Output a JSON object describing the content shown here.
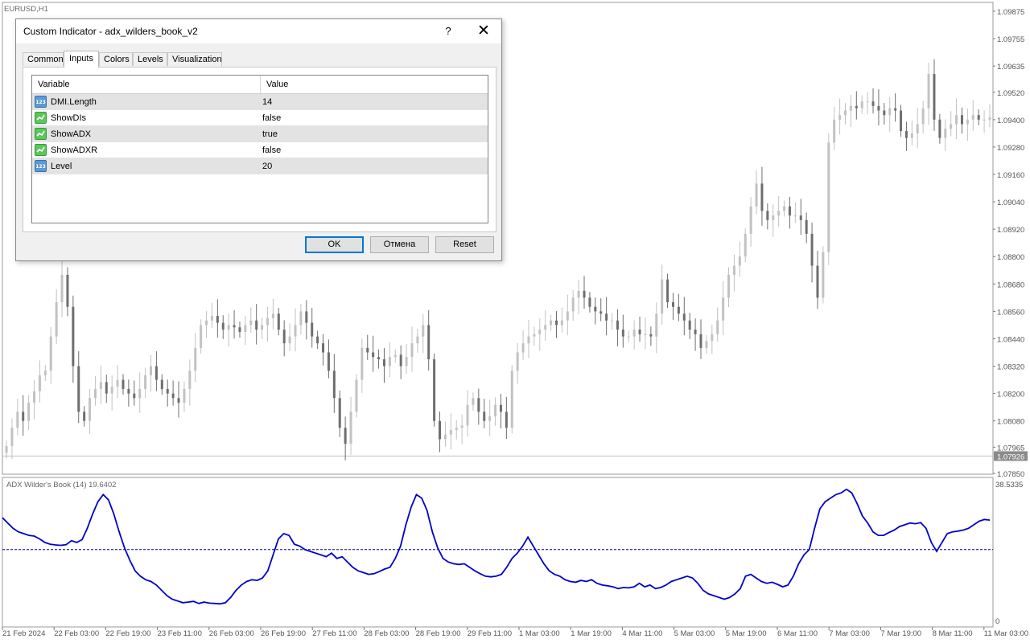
{
  "chart": {
    "symbol_label": "EURUSD,H1",
    "price_levels": [
      "1.09875",
      "1.09755",
      "1.09635",
      "1.09520",
      "1.09400",
      "1.09280",
      "1.09160",
      "1.09040",
      "1.08920",
      "1.08800",
      "1.08680",
      "1.08560",
      "1.08440",
      "1.08320",
      "1.08200",
      "1.08080",
      "1.07965",
      "1.07926",
      "1.07850"
    ],
    "current_price": "1.07926",
    "indicator_label": "ADX Wilder's Book (14) 19.6402",
    "indicator_max": "38.5335",
    "indicator_min": "0",
    "time_labels": [
      "21 Feb 2024",
      "22 Feb 03:00",
      "22 Feb 19:00",
      "23 Feb 11:00",
      "26 Feb 03:00",
      "26 Feb 19:00",
      "27 Feb 11:00",
      "28 Feb 03:00",
      "28 Feb 19:00",
      "29 Feb 11:00",
      "1 Mar 03:00",
      "1 Mar 19:00",
      "4 Mar 11:00",
      "5 Mar 03:00",
      "5 Mar 19:00",
      "6 Mar 11:00",
      "7 Mar 03:00",
      "7 Mar 19:00",
      "8 Mar 11:00",
      "11 Mar 03:00"
    ],
    "colors": {
      "candle": "#808080",
      "adx_line": "#0000cc",
      "level_line": "#000080",
      "grid_bg": "#ffffff"
    }
  },
  "chart_data": {
    "type": "line",
    "series": [
      {
        "name": "ADX Wilder's Book (14)",
        "values": [
          29.0,
          27.5,
          26.0,
          25.0,
          24.5,
          24.0,
          23.8,
          23.0,
          22.0,
          21.5,
          21.3,
          21.2,
          21.4,
          22.5,
          22.0,
          22.8,
          26.0,
          30.0,
          33.5,
          35.5,
          34.0,
          30.0,
          25.0,
          20.5,
          17.0,
          14.0,
          12.5,
          11.5,
          11.0,
          10.0,
          8.5,
          7.0,
          6.0,
          5.5,
          5.0,
          5.2,
          5.4,
          4.8,
          5.2,
          4.9,
          4.8,
          4.7,
          5.0,
          6.5,
          8.5,
          10.0,
          11.0,
          11.5,
          11.3,
          12.0,
          14.0,
          18.5,
          23.0,
          24.5,
          24.0,
          21.5,
          21.0,
          20.0,
          19.5,
          19.0,
          18.5,
          18.0,
          19.0,
          17.5,
          18.0,
          16.5,
          15.0,
          14.0,
          13.5,
          13.0,
          13.2,
          13.8,
          14.5,
          15.0,
          17.5,
          21.0,
          27.0,
          32.0,
          35.5,
          34.5,
          31.0,
          25.0,
          20.5,
          17.5,
          16.5,
          16.0,
          15.8,
          16.0,
          15.0,
          14.0,
          13.2,
          12.5,
          12.3,
          12.5,
          13.0,
          15.0,
          17.5,
          19.0,
          21.0,
          23.5,
          21.0,
          18.5,
          16.0,
          14.0,
          13.0,
          12.5,
          11.5,
          11.0,
          10.8,
          11.3,
          11.0,
          11.5,
          10.5,
          10.0,
          9.8,
          9.5,
          9.0,
          9.3,
          9.2,
          9.5,
          10.5,
          9.5,
          10.0,
          9.0,
          9.3,
          10.0,
          11.0,
          11.5,
          12.0,
          12.5,
          12.0,
          10.5,
          8.5,
          7.5,
          7.0,
          6.5,
          6.0,
          6.5,
          7.5,
          9.0,
          12.5,
          13.0,
          12.0,
          11.0,
          10.5,
          10.8,
          10.2,
          9.5,
          10.0,
          12.5,
          16.0,
          18.5,
          20.0,
          26.0,
          31.5,
          33.5,
          34.5,
          35.5,
          36.0,
          37.0,
          36.0,
          33.0,
          29.5,
          27.5,
          25.0,
          24.0,
          24.0,
          24.8,
          25.5,
          26.5,
          27.0,
          27.5,
          27.3,
          27.6,
          26.0,
          22.0,
          19.5,
          22.0,
          24.5,
          25.0,
          25.2,
          25.5,
          26.0,
          27.0,
          28.0,
          28.5,
          28.3
        ]
      }
    ],
    "level": 20,
    "ylim": [
      0,
      38.5335
    ],
    "x_tick_labels": [
      "21 Feb 2024",
      "22 Feb 03:00",
      "22 Feb 19:00",
      "23 Feb 11:00",
      "26 Feb 03:00",
      "26 Feb 19:00",
      "27 Feb 11:00",
      "28 Feb 03:00",
      "28 Feb 19:00",
      "29 Feb 11:00",
      "1 Mar 03:00",
      "1 Mar 19:00",
      "4 Mar 11:00",
      "5 Mar 03:00",
      "5 Mar 19:00",
      "6 Mar 11:00",
      "7 Mar 03:00",
      "7 Mar 19:00",
      "8 Mar 11:00",
      "11 Mar 03:00"
    ],
    "price_close": [
      1.0797,
      1.0805,
      1.0812,
      1.0808,
      1.0816,
      1.0821,
      1.0828,
      1.083,
      1.0845,
      1.086,
      1.0872,
      1.0858,
      1.0832,
      1.0812,
      1.0808,
      1.0818,
      1.0822,
      1.0825,
      1.082,
      1.0823,
      1.0826,
      1.0822,
      1.082,
      1.0818,
      1.0822,
      1.0828,
      1.0832,
      1.0826,
      1.0822,
      1.082,
      1.0818,
      1.0816,
      1.0822,
      1.083,
      1.084,
      1.085,
      1.0852,
      1.0854,
      1.0851,
      1.0848,
      1.085,
      1.0849,
      1.0847,
      1.085,
      1.0852,
      1.0848,
      1.085,
      1.0853,
      1.0855,
      1.0848,
      1.0842,
      1.0845,
      1.085,
      1.0856,
      1.0851,
      1.0845,
      1.0842,
      1.0838,
      1.083,
      1.0818,
      1.0805,
      1.0798,
      1.0812,
      1.0826,
      1.084,
      1.0838,
      1.0836,
      1.0835,
      1.0832,
      1.0836,
      1.0837,
      1.0832,
      1.0836,
      1.0842,
      1.0845,
      1.085,
      1.0835,
      1.0808,
      1.08,
      1.0802,
      1.0804,
      1.0805,
      1.0806,
      1.0815,
      1.0818,
      1.0812,
      1.0808,
      1.081,
      1.0815,
      1.0812,
      1.0805,
      1.083,
      1.0838,
      1.0842,
      1.0845,
      1.0846,
      1.0848,
      1.085,
      1.0852,
      1.085,
      1.0852,
      1.0856,
      1.0862,
      1.0865,
      1.0862,
      1.0858,
      1.0856,
      1.0855,
      1.0852,
      1.0852,
      1.0848,
      1.0845,
      1.0845,
      1.0848,
      1.0846,
      1.0846,
      1.0845,
      1.0855,
      1.087,
      1.086,
      1.0858,
      1.0855,
      1.0852,
      1.0848,
      1.0846,
      1.084,
      1.0843,
      1.0846,
      1.0852,
      1.0862,
      1.0872,
      1.0876,
      1.088,
      1.089,
      1.0902,
      1.0912,
      1.09,
      1.0896,
      1.0898,
      1.09,
      1.0902,
      1.0898,
      1.0898,
      1.0896,
      1.089,
      1.0876,
      1.0862,
      1.0882,
      1.093,
      1.094,
      1.0942,
      1.0944,
      1.0946,
      1.0945,
      1.0948,
      1.0948,
      1.0946,
      1.0944,
      1.0942,
      1.0945,
      1.0944,
      1.0935,
      1.0932,
      1.0934,
      1.0938,
      1.0945,
      1.096,
      1.094,
      1.0932,
      1.0936,
      1.0938,
      1.0942,
      1.0938,
      1.094,
      1.0942,
      1.094,
      1.094,
      1.0941
    ]
  },
  "dialog": {
    "title": "Custom Indicator - adx_wilders_book_v2",
    "help_label": "?",
    "close_label": "✕",
    "tabs": [
      {
        "label": "Common"
      },
      {
        "label": "Inputs"
      },
      {
        "label": "Colors"
      },
      {
        "label": "Levels"
      },
      {
        "label": "Visualization"
      }
    ],
    "active_tab": "Inputs",
    "table": {
      "headers": [
        "Variable",
        "Value"
      ],
      "rows": [
        {
          "icon": "number-icon",
          "variable": "DMI.Length",
          "value": "14"
        },
        {
          "icon": "boolean-icon",
          "variable": "ShowDIs",
          "value": "false"
        },
        {
          "icon": "boolean-icon",
          "variable": "ShowADX",
          "value": "true"
        },
        {
          "icon": "boolean-icon",
          "variable": "ShowADXR",
          "value": "false"
        },
        {
          "icon": "number-icon",
          "variable": "Level",
          "value": "20"
        }
      ]
    },
    "buttons": {
      "ok": "OK",
      "cancel": "Отмена",
      "reset": "Reset"
    },
    "number_icon_text": "123"
  }
}
